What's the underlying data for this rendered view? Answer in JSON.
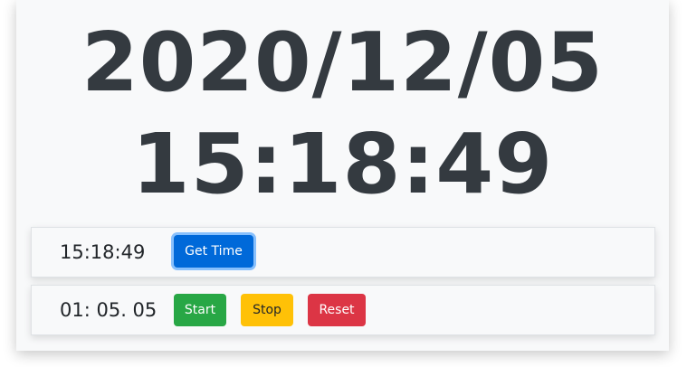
{
  "clock": {
    "date": "2020/12/05",
    "time": "15:18:49"
  },
  "get_time_row": {
    "value": "15:18:49",
    "button_label": "Get Time"
  },
  "stopwatch_row": {
    "value": "01: 05. 05",
    "start_label": "Start",
    "stop_label": "Stop",
    "reset_label": "Reset"
  },
  "colors": {
    "primary": "#0069d9",
    "success": "#28a745",
    "warning": "#ffc107",
    "danger": "#dc3545",
    "text_dark": "#343a40",
    "card_bg": "#f8f9fa"
  }
}
